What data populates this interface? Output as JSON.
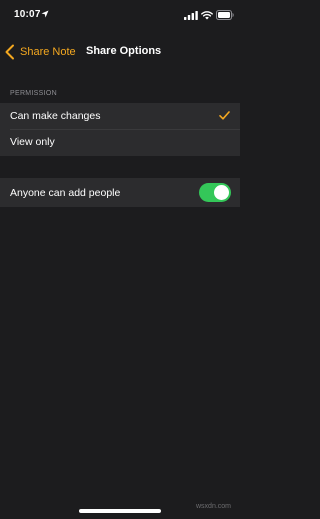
{
  "status_bar": {
    "time": "10:07"
  },
  "nav": {
    "back_label": "Share Note",
    "title": "Share Options"
  },
  "permission_section": {
    "header": "PERMISSION",
    "options": [
      {
        "label": "Can make changes",
        "selected": true
      },
      {
        "label": "View only",
        "selected": false
      }
    ]
  },
  "settings": {
    "anyone_can_add_people": {
      "label": "Anyone can add people",
      "enabled": true
    }
  },
  "colors": {
    "accent": "#f4a820",
    "toggle_on": "#34c759",
    "background": "#1c1c1e",
    "cell_background": "#2c2c2e"
  },
  "watermark": "wsxdn.com"
}
